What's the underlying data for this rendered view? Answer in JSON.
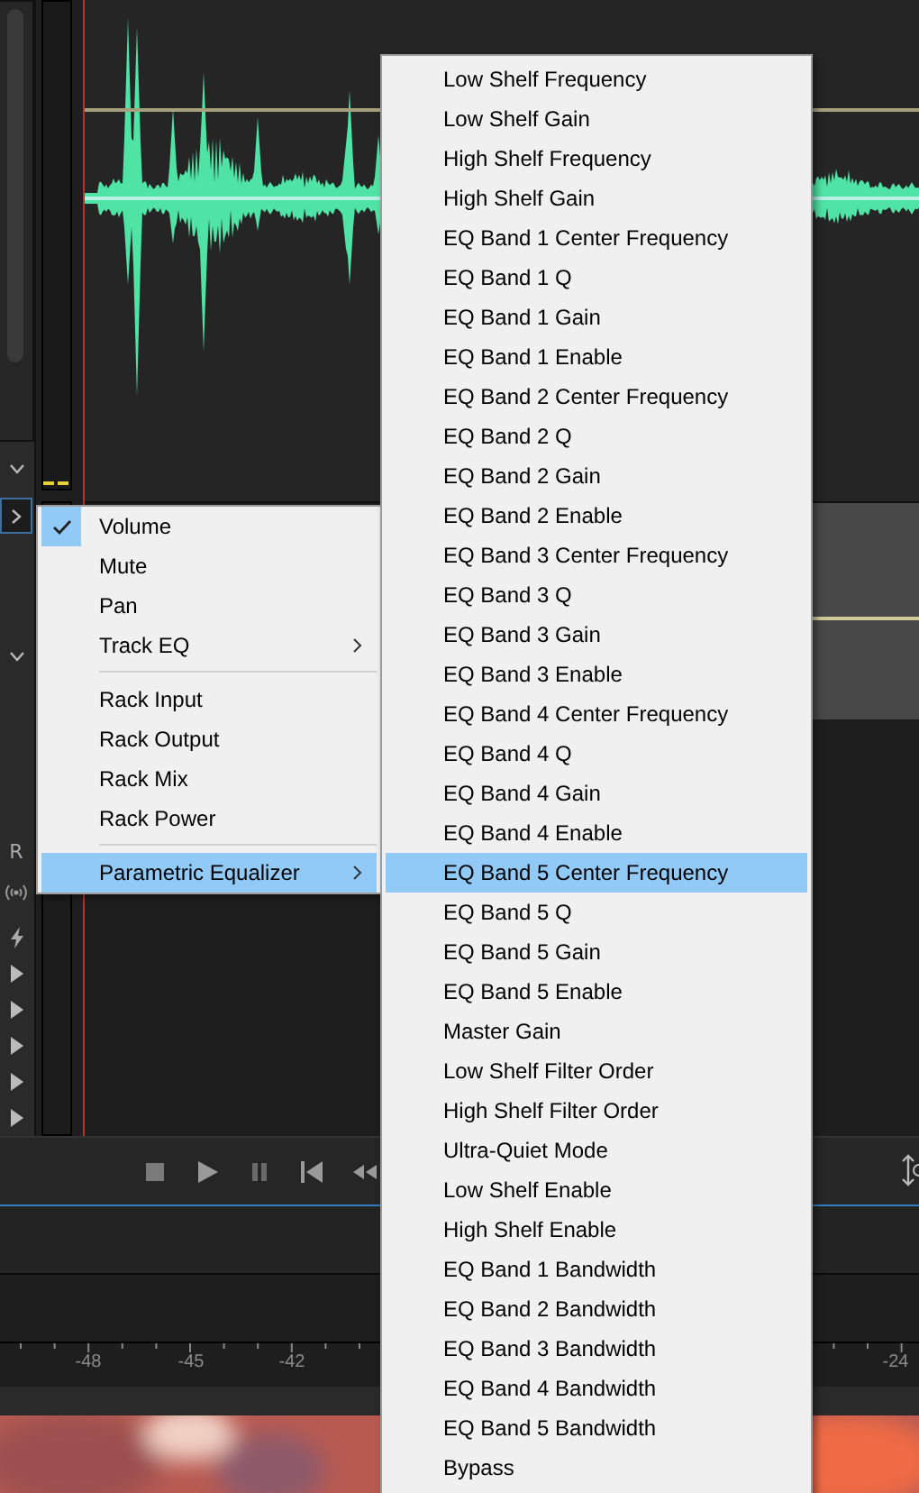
{
  "track_controls": {
    "record_label": "R"
  },
  "context_menu": {
    "items": [
      {
        "kind": "item",
        "label": "Volume",
        "checked": true,
        "has_submenu": false,
        "selected": false
      },
      {
        "kind": "item",
        "label": "Mute",
        "checked": false,
        "has_submenu": false,
        "selected": false
      },
      {
        "kind": "item",
        "label": "Pan",
        "checked": false,
        "has_submenu": false,
        "selected": false
      },
      {
        "kind": "item",
        "label": "Track EQ",
        "checked": false,
        "has_submenu": true,
        "selected": false
      },
      {
        "kind": "separator"
      },
      {
        "kind": "item",
        "label": "Rack Input",
        "checked": false,
        "has_submenu": false,
        "selected": false
      },
      {
        "kind": "item",
        "label": "Rack Output",
        "checked": false,
        "has_submenu": false,
        "selected": false
      },
      {
        "kind": "item",
        "label": "Rack Mix",
        "checked": false,
        "has_submenu": false,
        "selected": false
      },
      {
        "kind": "item",
        "label": "Rack Power",
        "checked": false,
        "has_submenu": false,
        "selected": false
      },
      {
        "kind": "separator"
      },
      {
        "kind": "item",
        "label": "Parametric Equalizer",
        "checked": false,
        "has_submenu": true,
        "selected": true
      }
    ]
  },
  "submenu": {
    "items": [
      {
        "label": "Low Shelf Frequency",
        "selected": false
      },
      {
        "label": "Low Shelf Gain",
        "selected": false
      },
      {
        "label": "High Shelf Frequency",
        "selected": false
      },
      {
        "label": "High Shelf Gain",
        "selected": false
      },
      {
        "label": "EQ Band 1 Center Frequency",
        "selected": false
      },
      {
        "label": "EQ Band 1 Q",
        "selected": false
      },
      {
        "label": "EQ Band 1 Gain",
        "selected": false
      },
      {
        "label": "EQ Band 1 Enable",
        "selected": false
      },
      {
        "label": "EQ Band 2 Center Frequency",
        "selected": false
      },
      {
        "label": "EQ Band 2 Q",
        "selected": false
      },
      {
        "label": "EQ Band 2 Gain",
        "selected": false
      },
      {
        "label": "EQ Band 2 Enable",
        "selected": false
      },
      {
        "label": "EQ Band 3 Center Frequency",
        "selected": false
      },
      {
        "label": "EQ Band 3 Q",
        "selected": false
      },
      {
        "label": "EQ Band 3 Gain",
        "selected": false
      },
      {
        "label": "EQ Band 3 Enable",
        "selected": false
      },
      {
        "label": "EQ Band 4 Center Frequency",
        "selected": false
      },
      {
        "label": "EQ Band 4 Q",
        "selected": false
      },
      {
        "label": "EQ Band 4 Gain",
        "selected": false
      },
      {
        "label": "EQ Band 4 Enable",
        "selected": false
      },
      {
        "label": "EQ Band 5 Center Frequency",
        "selected": true
      },
      {
        "label": "EQ Band 5 Q",
        "selected": false
      },
      {
        "label": "EQ Band 5 Gain",
        "selected": false
      },
      {
        "label": "EQ Band 5 Enable",
        "selected": false
      },
      {
        "label": "Master Gain",
        "selected": false
      },
      {
        "label": "Low Shelf Filter Order",
        "selected": false
      },
      {
        "label": "High Shelf Filter Order",
        "selected": false
      },
      {
        "label": "Ultra-Quiet Mode",
        "selected": false
      },
      {
        "label": "Low Shelf Enable",
        "selected": false
      },
      {
        "label": "High Shelf Enable",
        "selected": false
      },
      {
        "label": "EQ Band 1 Bandwidth",
        "selected": false
      },
      {
        "label": "EQ Band 2 Bandwidth",
        "selected": false
      },
      {
        "label": "EQ Band 3 Bandwidth",
        "selected": false
      },
      {
        "label": "EQ Band 4 Bandwidth",
        "selected": false
      },
      {
        "label": "EQ Band 5 Bandwidth",
        "selected": false
      },
      {
        "label": "Bypass",
        "selected": false
      }
    ]
  },
  "ruler": {
    "labels": [
      "-48",
      "-45",
      "-42",
      "-24"
    ]
  }
}
